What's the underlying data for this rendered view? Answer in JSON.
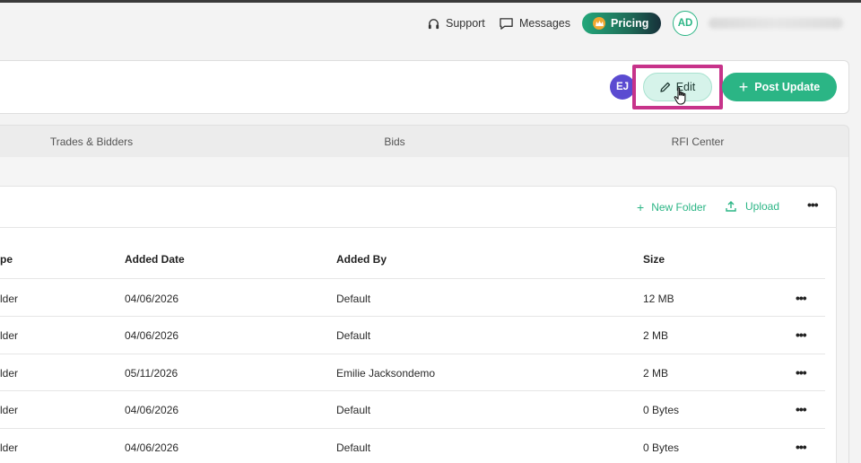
{
  "topbar": {
    "support_label": "Support",
    "messages_label": "Messages",
    "pricing_label": "Pricing",
    "avatar_initials": "AD"
  },
  "project_header": {
    "member_initials": "EJ",
    "edit_label": "Edit",
    "post_update_label": "Post Update"
  },
  "tabs": [
    {
      "label": "Trades & Bidders"
    },
    {
      "label": "Bids"
    },
    {
      "label": "RFI Center"
    }
  ],
  "files": {
    "new_folder_label": "New Folder",
    "upload_label": "Upload",
    "columns": [
      "pe",
      "Added Date",
      "Added By",
      "Size"
    ],
    "rows": [
      {
        "type": "lder",
        "date": "04/06/2026",
        "by": "Default",
        "size": "12 MB"
      },
      {
        "type": "lder",
        "date": "04/06/2026",
        "by": "Default",
        "size": "2 MB"
      },
      {
        "type": "lder",
        "date": "05/11/2026",
        "by": "Emilie Jacksondemo",
        "size": "2 MB"
      },
      {
        "type": "lder",
        "date": "04/06/2026",
        "by": "Default",
        "size": "0 Bytes"
      },
      {
        "type": "lder",
        "date": "04/06/2026",
        "by": "Default",
        "size": "0 Bytes"
      }
    ]
  },
  "colors": {
    "accent": "#2bb585",
    "highlight": "#c7338a",
    "member_avatar": "#5b4bd1"
  }
}
